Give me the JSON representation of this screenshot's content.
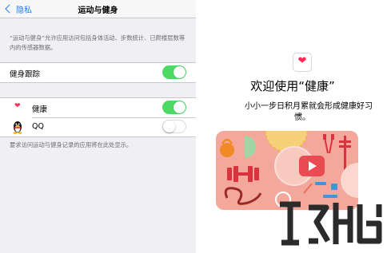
{
  "settings": {
    "back_label": "隐私",
    "title": "运动与健身",
    "description": "“运动与健身”允许应用访问包括身体活动、步数统计、已爬楼层数等内的传感器数据。",
    "tracking_label": "健身跟踪",
    "tracking_on": true,
    "apps": [
      {
        "label": "健康",
        "icon": "heart-icon",
        "enabled": true
      },
      {
        "label": "QQ",
        "icon": "qq-penguin-icon",
        "enabled": false
      }
    ],
    "footnote": "要求访问运动与健身记录的应用将在此处显示。"
  },
  "health": {
    "welcome_title": "欢迎使用“健康”",
    "subtitle_line1": "小小一步日积月累就会形成健康好习",
    "subtitle_line2": "惯。",
    "icon": "health-app-heart-icon"
  },
  "colors": {
    "ios_blue": "#1f7ef0",
    "toggle_green": "#4cd964",
    "health_pink": "#ff2d55",
    "card_salmon": "#f4a79b",
    "play_red": "#ea4a52"
  }
}
